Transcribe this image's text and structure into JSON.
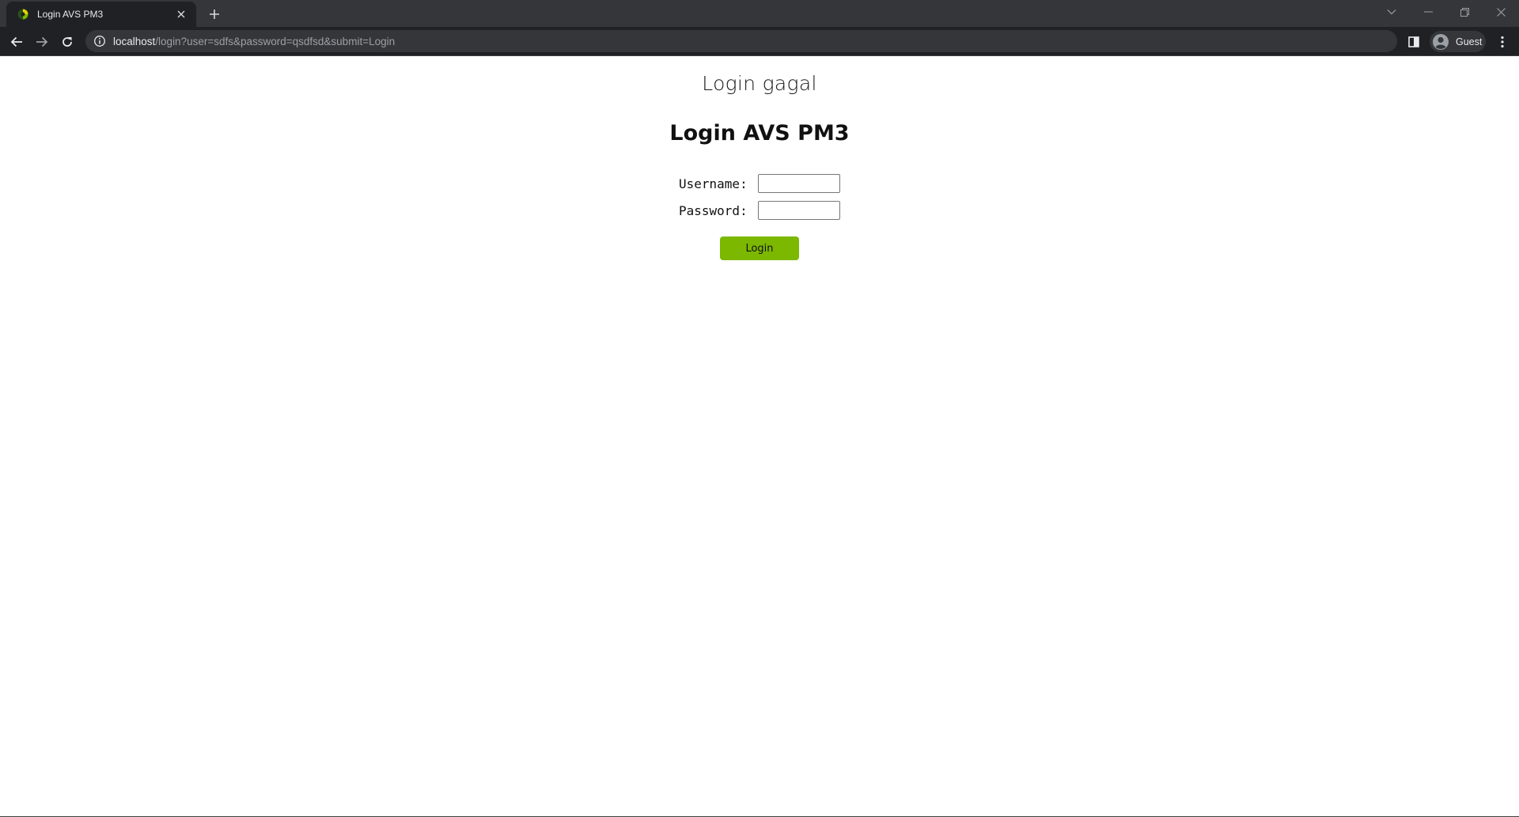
{
  "browser": {
    "tab": {
      "title": "Login AVS PM3"
    },
    "url": {
      "host": "localhost",
      "path": "/login?user=sdfs&password=qsdfsd&submit=Login"
    },
    "profile": {
      "label": "Guest"
    }
  },
  "page": {
    "status_message": "Login gagal",
    "title": "Login AVS PM3",
    "form": {
      "username_label": "Username:",
      "username_value": "",
      "password_label": "Password:",
      "password_value": "",
      "submit_label": "Login"
    }
  },
  "colors": {
    "button_bg": "#7cb800",
    "chrome_dark": "#202124",
    "tabstrip": "#35363a"
  },
  "icons": [
    "favicon-icon",
    "close-icon",
    "plus-icon",
    "chevron-down-icon",
    "minimize-icon",
    "restore-icon",
    "window-close-icon",
    "back-arrow-icon",
    "forward-arrow-icon",
    "reload-icon",
    "info-icon",
    "side-panel-icon",
    "profile-avatar-icon",
    "kebab-menu-icon"
  ]
}
